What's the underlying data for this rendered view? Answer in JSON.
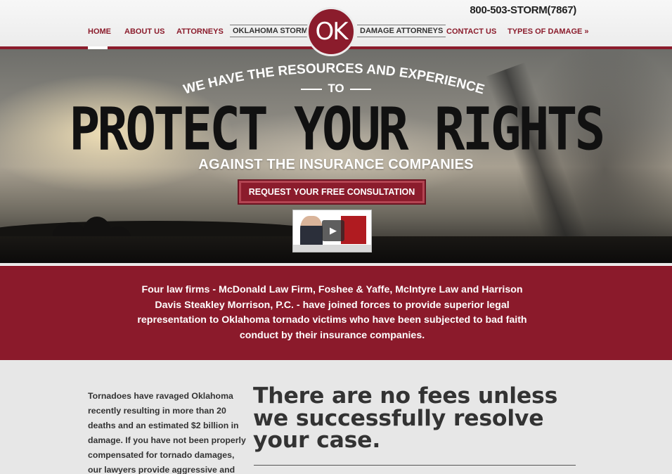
{
  "header": {
    "phone": "800-503-STORM(7867)",
    "logo_text": "OK",
    "nav": [
      {
        "label": "HOME"
      },
      {
        "label": "ABOUT US"
      },
      {
        "label": "ATTORNEYS"
      },
      {
        "label": "OKLAHOMA STORM"
      },
      {
        "label": "DAMAGE ATTORNEYS"
      },
      {
        "label": "CONTACT US"
      },
      {
        "label": "TYPES OF DAMAGE »"
      }
    ]
  },
  "hero": {
    "tagline": "WE HAVE THE RESOURCES AND EXPERIENCE",
    "to": "TO",
    "headline": "PROTECT YOUR RIGHTS",
    "subhead": "AGAINST THE INSURANCE COMPANIES",
    "cta": "REQUEST YOUR FREE CONSULTATION",
    "video_icon": "play-icon"
  },
  "band": {
    "text": "Four law firms - McDonald Law Firm, Foshee & Yaffe, McIntyre Law and Harrison Davis Steakley Morrison, P.C. - have joined forces to provide superior legal representation to Oklahoma tornado victims who have been subjected to bad faith conduct by their insurance companies."
  },
  "main": {
    "intro": "Tornadoes have ravaged Oklahoma recently resulting in more than 20 deaths and an estimated $2 billion in damage. If you have not been properly compensated for tornado damages, our lawyers provide aggressive and",
    "claim": "There are no fees unless we successfully resolve your case."
  },
  "colors": {
    "brand": "#8b1c2c",
    "text_dark": "#333333"
  }
}
